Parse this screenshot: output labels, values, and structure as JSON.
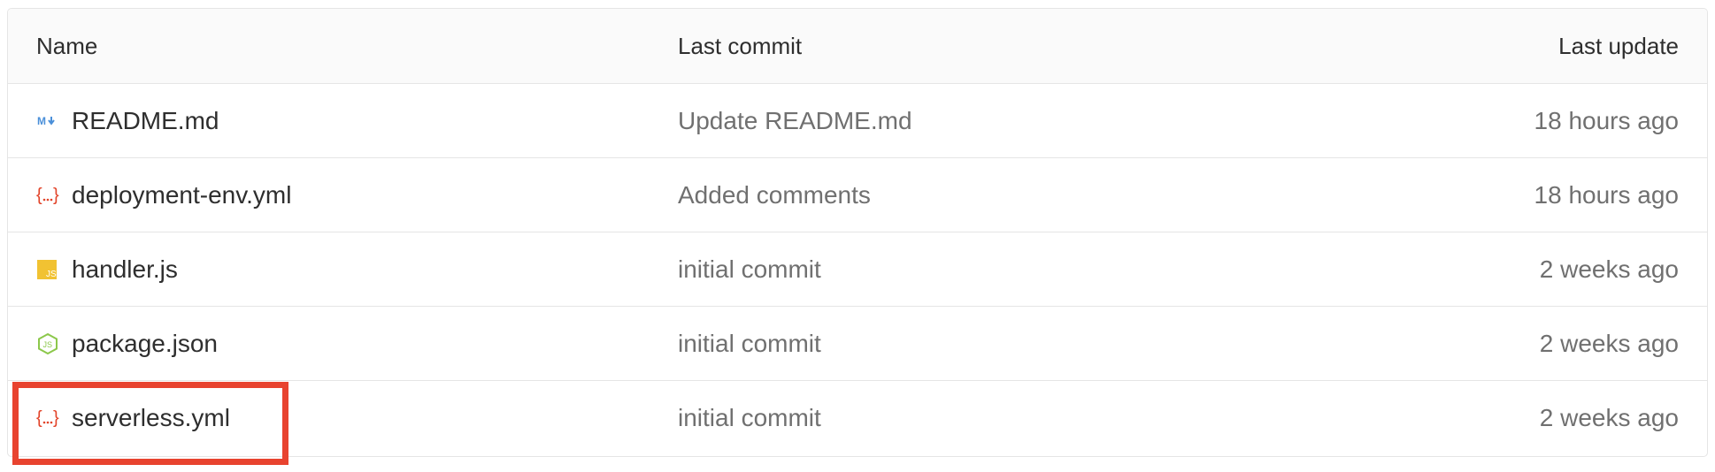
{
  "columns": {
    "name": "Name",
    "last_commit": "Last commit",
    "last_update": "Last update"
  },
  "files": [
    {
      "name": "README.md",
      "icon": "markdown-icon",
      "commit": "Update README.md",
      "updated": "18 hours ago"
    },
    {
      "name": "deployment-env.yml",
      "icon": "yaml-icon",
      "commit": "Added comments",
      "updated": "18 hours ago"
    },
    {
      "name": "handler.js",
      "icon": "javascript-icon",
      "commit": "initial commit",
      "updated": "2 weeks ago"
    },
    {
      "name": "package.json",
      "icon": "nodejs-icon",
      "commit": "initial commit",
      "updated": "2 weeks ago"
    },
    {
      "name": "serverless.yml",
      "icon": "yaml-icon",
      "commit": "initial commit",
      "updated": "2 weeks ago"
    }
  ],
  "colors": {
    "highlight": "#e8432f",
    "markdown_icon": "#4a8fd9",
    "yaml_icon": "#e24329",
    "javascript_icon": "#f1c232",
    "nodejs_icon": "#8cc84b"
  }
}
